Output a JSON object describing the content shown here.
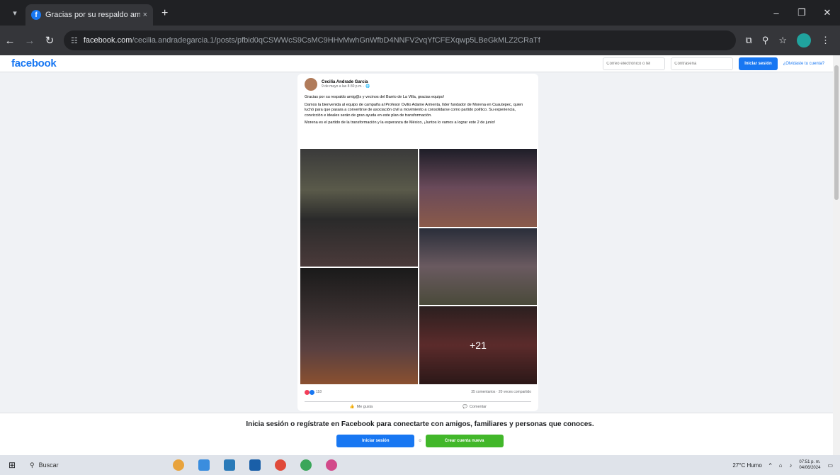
{
  "browser": {
    "tab_title": "Gracias por su respaldo amig©",
    "tab_close": "×",
    "new_tab": "+",
    "url_domain": "facebook.com",
    "url_path": "/cecilia.andradegarcia.1/posts/pfbid0qCSWWcS9CsMC9HHvMwhGnWfbD4NNFV2vqYfCFEXqwp5LBeGkMLZ2CRaTf",
    "win_min": "–",
    "win_max": "❐",
    "win_close": "✕"
  },
  "fb_header": {
    "logo": "facebook",
    "email_placeholder": "Correo electrónico o tel",
    "password_placeholder": "Contraseña",
    "login_button": "Iniciar sesión",
    "forgot_link": "¿Olvidaste tu cuenta?"
  },
  "post": {
    "author": "Cecilia Andrade García",
    "meta": "9 de mayo a las 8:30 p.m. · 🌐",
    "paragraphs": [
      "Gracias por su respaldo amig@s y vecinos del Barrio de La Villa, gracias equipo!",
      "Damos la bienvenida al equipo de campaña al Profesor Ovilio Adame Armenta, líder fundador de Morena en Cuautepec, quien luchó para que pasara a convertirse de asociación civil a movimiento a consolidarse como partido político. Su experiencia, convicción e ideales serán de gran ayuda en este plan de transformación.",
      "Morena es el partido de la transformación y la esperanza de México, ¡Juntos lo vamos a lograr este 2 de junio!"
    ],
    "more_photos": "+21",
    "reaction_count": "118",
    "stats_right": "35 comentarios · 20 veces compartido",
    "like_label": "Me gusta",
    "comment_label": "Comentar"
  },
  "bottom_prompt": {
    "text": "Inicia sesión o regístrate en Facebook para conectarte con amigos, familiares y personas que conoces.",
    "login_button": "Iniciar sesión",
    "separator": "o",
    "create_button": "Crear cuenta nueva"
  },
  "taskbar": {
    "search_label": "Buscar",
    "weather": "27°C  Humo",
    "time": "07:51 p. m.",
    "date": "04/06/2024"
  },
  "colors": {
    "fb_blue": "#1877f2",
    "fb_green": "#42b72a"
  }
}
